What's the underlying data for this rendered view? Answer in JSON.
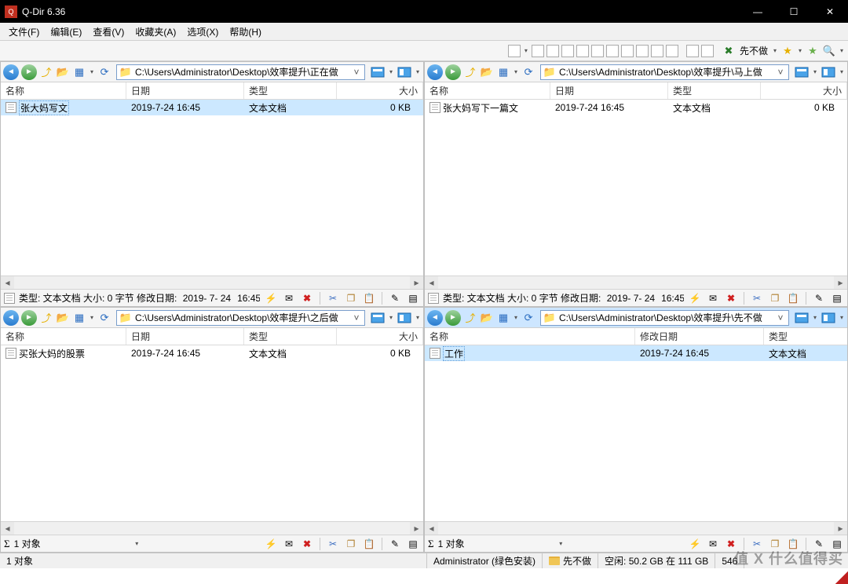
{
  "app": {
    "title": "Q-Dir 6.36"
  },
  "menu": {
    "file": "文件(F)",
    "edit": "编辑(E)",
    "view": "查看(V)",
    "fav": "收藏夹(A)",
    "opts": "选项(X)",
    "help": "帮助(H)"
  },
  "apptb": {
    "priority": "先不做"
  },
  "columns": {
    "name": "名称",
    "date": "日期",
    "moddate": "修改日期",
    "type": "类型",
    "size": "大小"
  },
  "panes": {
    "p1": {
      "path": "C:\\Users\\Administrator\\Desktop\\效率提升\\正在做",
      "file": {
        "name": "张大妈写文",
        "date": "2019-7-24 16:45",
        "type": "文本文档",
        "size": "0 KB"
      },
      "status_info": "类型: 文本文档 大小: 0 字节 修改日期: ",
      "status_date": "2019- 7- 24",
      "status_time": "16:45"
    },
    "p2": {
      "path": "C:\\Users\\Administrator\\Desktop\\效率提升\\马上做",
      "file": {
        "name": "张大妈写下一篇文",
        "date": "2019-7-24 16:45",
        "type": "文本文档",
        "size": "0 KB"
      },
      "status_info": "类型: 文本文档 大小: 0 字节 修改日期: ",
      "status_date": "2019- 7- 24",
      "status_time": "16:45"
    },
    "p3": {
      "path": "C:\\Users\\Administrator\\Desktop\\效率提升\\之后做",
      "file": {
        "name": "买张大妈的股票",
        "date": "2019-7-24 16:45",
        "type": "文本文档",
        "size": "0 KB"
      },
      "status_count": "1 对象"
    },
    "p4": {
      "path": "C:\\Users\\Administrator\\Desktop\\效率提升\\先不做",
      "file": {
        "name": "工作",
        "date": "2019-7-24 16:45",
        "type": "文本文档"
      },
      "status_count": "1 对象"
    }
  },
  "bottom": {
    "count": "1 对象",
    "user": "Administrator (绿色安装)",
    "folder": "先不做",
    "space": "空闲: 50.2 GB 在 111 GB",
    "num": "546"
  },
  "watermark": "值 X 什么值得买"
}
